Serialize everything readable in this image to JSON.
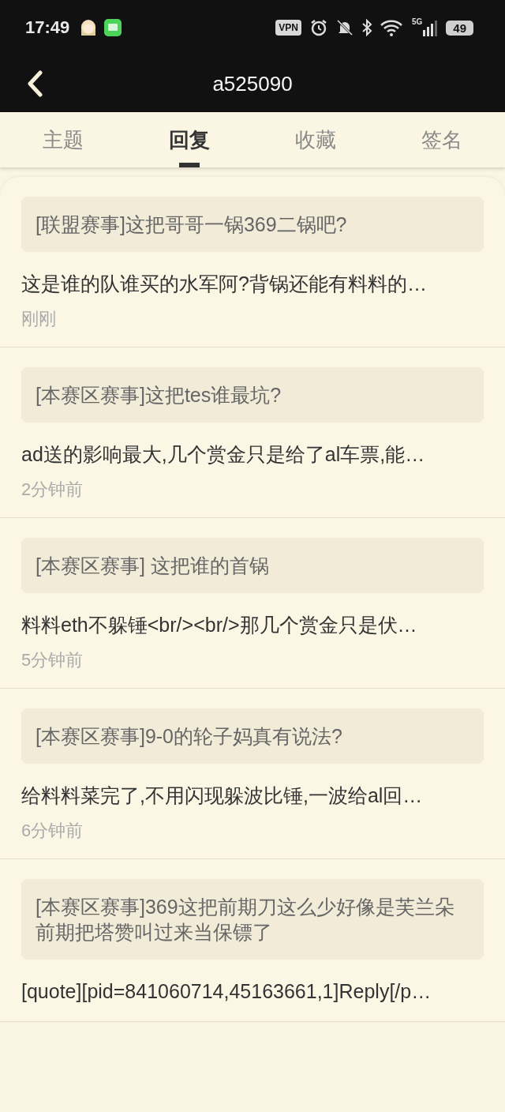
{
  "status_bar": {
    "time": "17:49",
    "vpn": "VPN",
    "network": "5G",
    "battery": "49"
  },
  "header": {
    "title": "a525090"
  },
  "tabs": [
    {
      "label": "主题",
      "selected": false
    },
    {
      "label": "回复",
      "selected": true
    },
    {
      "label": "收藏",
      "selected": false
    },
    {
      "label": "签名",
      "selected": false
    }
  ],
  "replies": [
    {
      "topic": "[联盟赛事]这把哥哥一锅369二锅吧?",
      "content": "这是谁的队谁买的水军阿?背锅还能有料料的…",
      "time": "刚刚"
    },
    {
      "topic": "[本赛区赛事]这把tes谁最坑?",
      "content": "ad送的影响最大,几个赏金只是给了al车票,能…",
      "time": "2分钟前"
    },
    {
      "topic": "[本赛区赛事] 这把谁的首锅",
      "content": "料料eth不躲锤<br/><br/>那几个赏金只是伏…",
      "time": "5分钟前"
    },
    {
      "topic": "[本赛区赛事]9-0的轮子妈真有说法?",
      "content": "给料料菜完了,不用闪现躲波比锤,一波给al回…",
      "time": "6分钟前"
    },
    {
      "topic": "[本赛区赛事]369这把前期刀这么少好像是芙兰朵前期把塔赞叫过来当保镖了",
      "content": "[quote][pid=841060714,45163661,1]Reply[/p…"
    }
  ]
}
